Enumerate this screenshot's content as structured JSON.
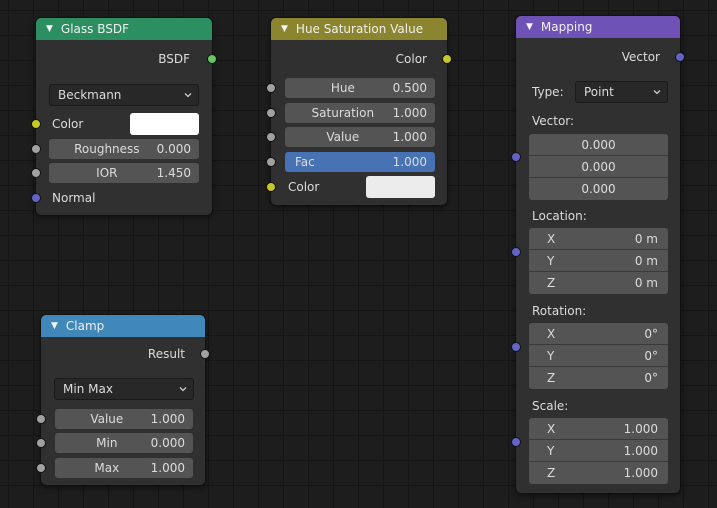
{
  "nodes": {
    "glass_bsdf": {
      "title": "Glass BSDF",
      "header_color": "#2b8f62",
      "output_label": "BSDF",
      "distribution": "Beckmann",
      "color_label": "Color",
      "color_value": "#ffffff",
      "roughness_label": "Roughness",
      "roughness_value": "0.000",
      "ior_label": "IOR",
      "ior_value": "1.450",
      "normal_label": "Normal"
    },
    "hue_saturation_value": {
      "title": "Hue Saturation Value",
      "header_color": "#8b8530",
      "output_label": "Color",
      "hue_label": "Hue",
      "hue_value": "0.500",
      "saturation_label": "Saturation",
      "saturation_value": "1.000",
      "value_label": "Value",
      "value_value": "1.000",
      "fac_label": "Fac",
      "fac_value": "1.000",
      "color_label": "Color",
      "color_value": "#ececec"
    },
    "clamp": {
      "title": "Clamp",
      "header_color": "#3f88b9",
      "output_label": "Result",
      "mode": "Min Max",
      "value_label": "Value",
      "value_value": "1.000",
      "min_label": "Min",
      "min_value": "0.000",
      "max_label": "Max",
      "max_value": "1.000"
    },
    "mapping": {
      "title": "Mapping",
      "header_color": "#6e52b5",
      "output_label": "Vector",
      "type_label": "Type:",
      "type_value": "Point",
      "vector_label": "Vector:",
      "vector_values": [
        "0.000",
        "0.000",
        "0.000"
      ],
      "location_label": "Location:",
      "location": [
        {
          "axis": "X",
          "value": "0 m"
        },
        {
          "axis": "Y",
          "value": "0 m"
        },
        {
          "axis": "Z",
          "value": "0 m"
        }
      ],
      "rotation_label": "Rotation:",
      "rotation": [
        {
          "axis": "X",
          "value": "0°"
        },
        {
          "axis": "Y",
          "value": "0°"
        },
        {
          "axis": "Z",
          "value": "0°"
        }
      ],
      "scale_label": "Scale:",
      "scale": [
        {
          "axis": "X",
          "value": "1.000"
        },
        {
          "axis": "Y",
          "value": "1.000"
        },
        {
          "axis": "Z",
          "value": "1.000"
        }
      ]
    }
  }
}
